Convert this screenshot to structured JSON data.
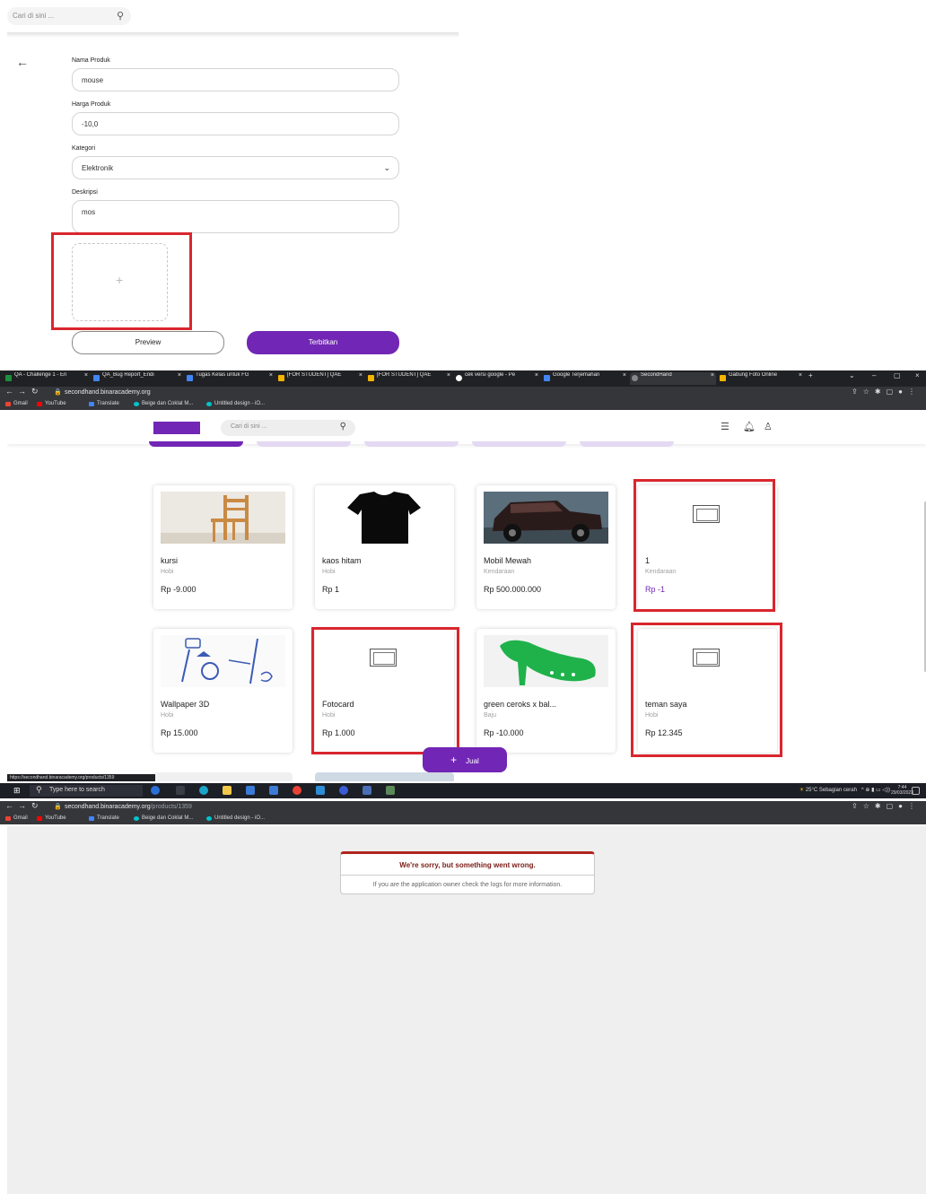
{
  "form": {
    "search_placeholder": "Cari di sini ...",
    "name_label": "Nama Produk",
    "name_value": "mouse",
    "price_label": "Harga Produk",
    "price_value": "-10,0",
    "category_label": "Kategori",
    "category_value": "Elektronik",
    "desc_label": "Deskripsi",
    "desc_value": "mos",
    "preview_label": "Preview",
    "publish_label": "Terbitkan"
  },
  "browser": {
    "tabs": [
      {
        "title": "QA - Challenge 1 - En",
        "color": "#1e8e3e"
      },
      {
        "title": "QA_Bug Report_Endi",
        "color": "#4285f4"
      },
      {
        "title": "Tugas Kelas untuk FG",
        "color": "#4285f4"
      },
      {
        "title": "[FOR STUDENT] QAE",
        "color": "#f4b400"
      },
      {
        "title": "[FOR STUDENT] QAE",
        "color": "#f4b400"
      },
      {
        "title": "cek versi google - Pe",
        "color": "#ffffff"
      },
      {
        "title": "Google Terjemahan",
        "color": "#4285f4"
      },
      {
        "title": "SecondHand",
        "color": "#888888"
      },
      {
        "title": "Gabung Foto Online",
        "color": "#f4b400"
      }
    ],
    "url_host": "secondhand.binaracademy.org",
    "url_path_error": "/products/1359",
    "bookmarks": [
      {
        "label": "Gmail",
        "color": "#ea4335"
      },
      {
        "label": "YouTube",
        "color": "#ff0000"
      },
      {
        "label": "Translate",
        "color": "#4285f4"
      },
      {
        "label": "Beige dan Coklat M...",
        "color": "#00c4cc"
      },
      {
        "label": "Untitled design - iO...",
        "color": "#00c4cc"
      }
    ]
  },
  "listing": {
    "search_placeholder": "Cari di sini ...",
    "products": [
      {
        "name": "kursi",
        "category": "Hobi",
        "price": "Rp -9.000",
        "image": "chair-image"
      },
      {
        "name": "kaos hitam",
        "category": "Hobi",
        "price": "Rp 1",
        "image": "tshirt-image"
      },
      {
        "name": "Mobil Mewah",
        "category": "Kendaraan",
        "price": "Rp 500.000.000",
        "image": "car-image"
      },
      {
        "name": "1",
        "category": "Kendaraan",
        "price": "Rp -1",
        "image": "placeholder"
      },
      {
        "name": "Wallpaper 3D",
        "category": "Hobi",
        "price": "Rp 15.000",
        "image": "wallpaper-image"
      },
      {
        "name": "Fotocard",
        "category": "Hobi",
        "price": "Rp 1.000",
        "image": "placeholder"
      },
      {
        "name": "green ceroks x bal...",
        "category": "Baju",
        "price": "Rp -10.000",
        "image": "shoe-image"
      },
      {
        "name": "teman saya",
        "category": "Hobi",
        "price": "Rp 12.345",
        "image": "placeholder"
      }
    ],
    "sell_button": "Jual",
    "status_url": "https://secondhand.binaracademy.org/products/1359"
  },
  "taskbar": {
    "search_placeholder": "Type here to search",
    "weather": "25°C  Sebagian cerah",
    "time": "7:44",
    "date": "29/03/2023"
  },
  "error": {
    "title": "We're sorry, but something went wrong.",
    "message": "If you are the application owner check the logs for more information."
  }
}
